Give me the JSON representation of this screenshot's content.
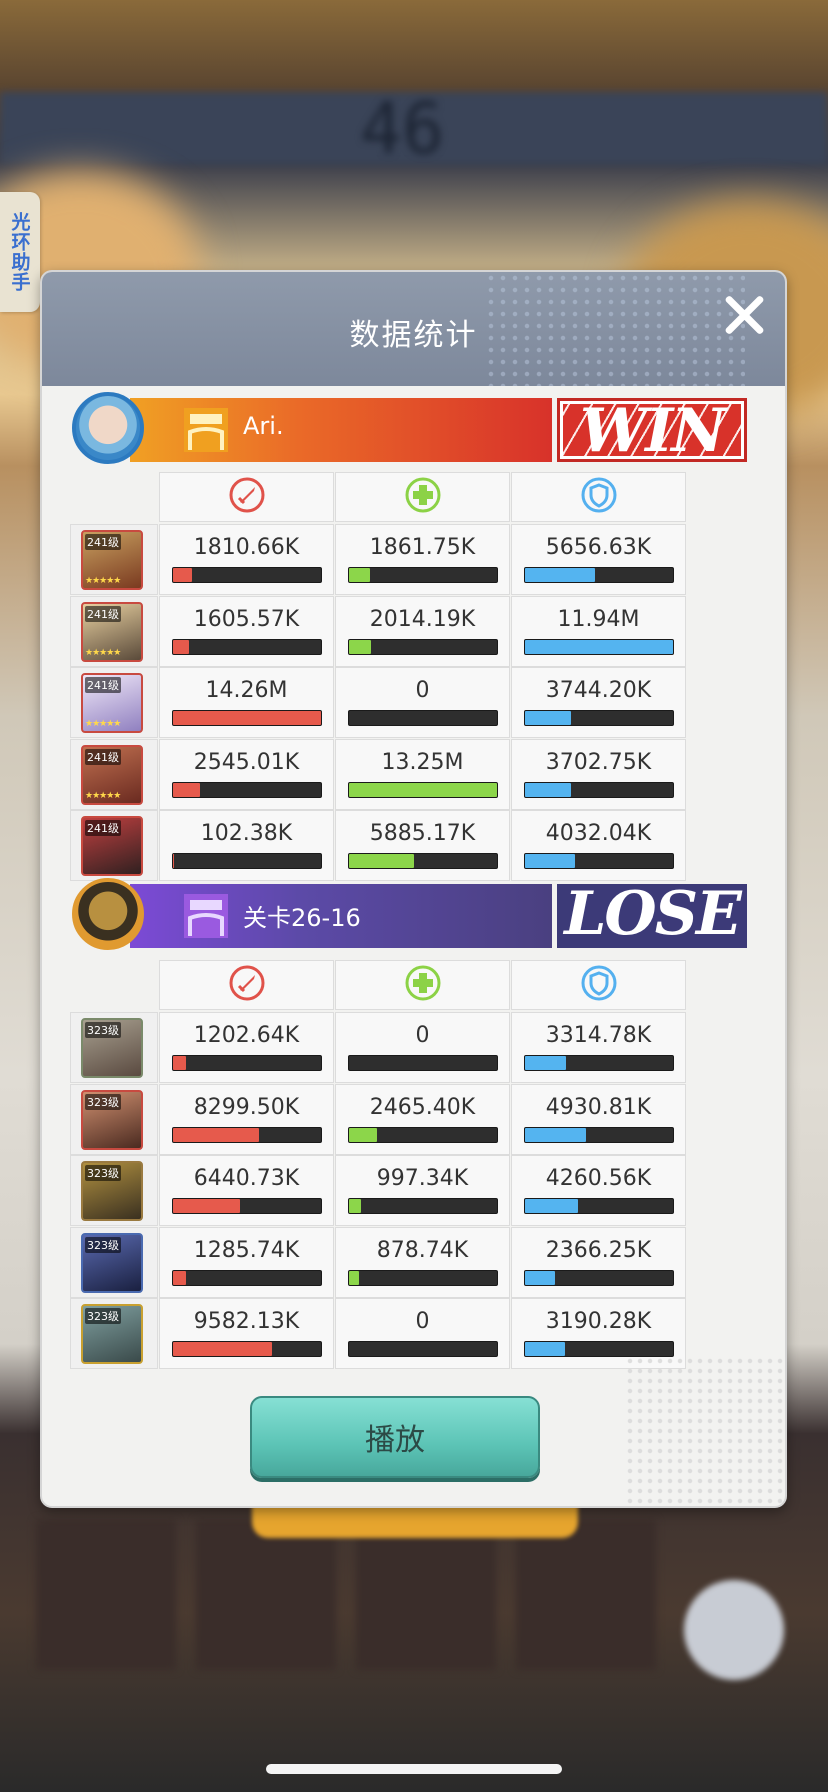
{
  "modal": {
    "title": "数据统计"
  },
  "side_tab": {
    "label": "光环助手"
  },
  "play_button": {
    "label": "播放"
  },
  "teams": [
    {
      "name": "Ari.",
      "result": "WIN",
      "rows": [
        {
          "level": "241级",
          "stars": "★★★★★",
          "damage": "1810.66K",
          "heal": "1861.75K",
          "defense": "5656.63K",
          "dmg_ratio": 0.13,
          "heal_ratio": 0.14,
          "def_ratio": 0.47
        },
        {
          "level": "241级",
          "stars": "★★★★★",
          "damage": "1605.57K",
          "heal": "2014.19K",
          "defense": "11.94M",
          "dmg_ratio": 0.11,
          "heal_ratio": 0.15,
          "def_ratio": 1.0
        },
        {
          "level": "241级",
          "stars": "★★★★★",
          "damage": "14.26M",
          "heal": "0",
          "defense": "3744.20K",
          "dmg_ratio": 1.0,
          "heal_ratio": 0.0,
          "def_ratio": 0.31
        },
        {
          "level": "241级",
          "stars": "★★★★★",
          "damage": "2545.01K",
          "heal": "13.25M",
          "defense": "3702.75K",
          "dmg_ratio": 0.18,
          "heal_ratio": 1.0,
          "def_ratio": 0.31
        },
        {
          "level": "241级",
          "stars": "",
          "damage": "102.38K",
          "heal": "5885.17K",
          "defense": "4032.04K",
          "dmg_ratio": 0.01,
          "heal_ratio": 0.44,
          "def_ratio": 0.34
        }
      ]
    },
    {
      "name": "关卡26-16",
      "result": "LOSE",
      "rows": [
        {
          "level": "323级",
          "stars": "",
          "damage": "1202.64K",
          "heal": "0",
          "defense": "3314.78K",
          "dmg_ratio": 0.09,
          "heal_ratio": 0.0,
          "def_ratio": 0.28
        },
        {
          "level": "323级",
          "stars": "",
          "damage": "8299.50K",
          "heal": "2465.40K",
          "defense": "4930.81K",
          "dmg_ratio": 0.58,
          "heal_ratio": 0.19,
          "def_ratio": 0.41
        },
        {
          "level": "323级",
          "stars": "",
          "damage": "6440.73K",
          "heal": "997.34K",
          "defense": "4260.56K",
          "dmg_ratio": 0.45,
          "heal_ratio": 0.08,
          "def_ratio": 0.36
        },
        {
          "level": "323级",
          "stars": "",
          "damage": "1285.74K",
          "heal": "878.74K",
          "defense": "2366.25K",
          "dmg_ratio": 0.09,
          "heal_ratio": 0.07,
          "def_ratio": 0.2
        },
        {
          "level": "323级",
          "stars": "",
          "damage": "9582.13K",
          "heal": "0",
          "defense": "3190.28K",
          "dmg_ratio": 0.67,
          "heal_ratio": 0.0,
          "def_ratio": 0.27
        }
      ]
    }
  ],
  "colors": {
    "damage": "#e65a4c",
    "heal": "#8cd64a",
    "defense": "#54b4f0",
    "win": "#d8322a",
    "lose": "#3c3a78"
  },
  "icons": {
    "damage": "damage-sword-icon",
    "heal": "heal-plus-icon",
    "defense": "defense-shield-icon"
  }
}
